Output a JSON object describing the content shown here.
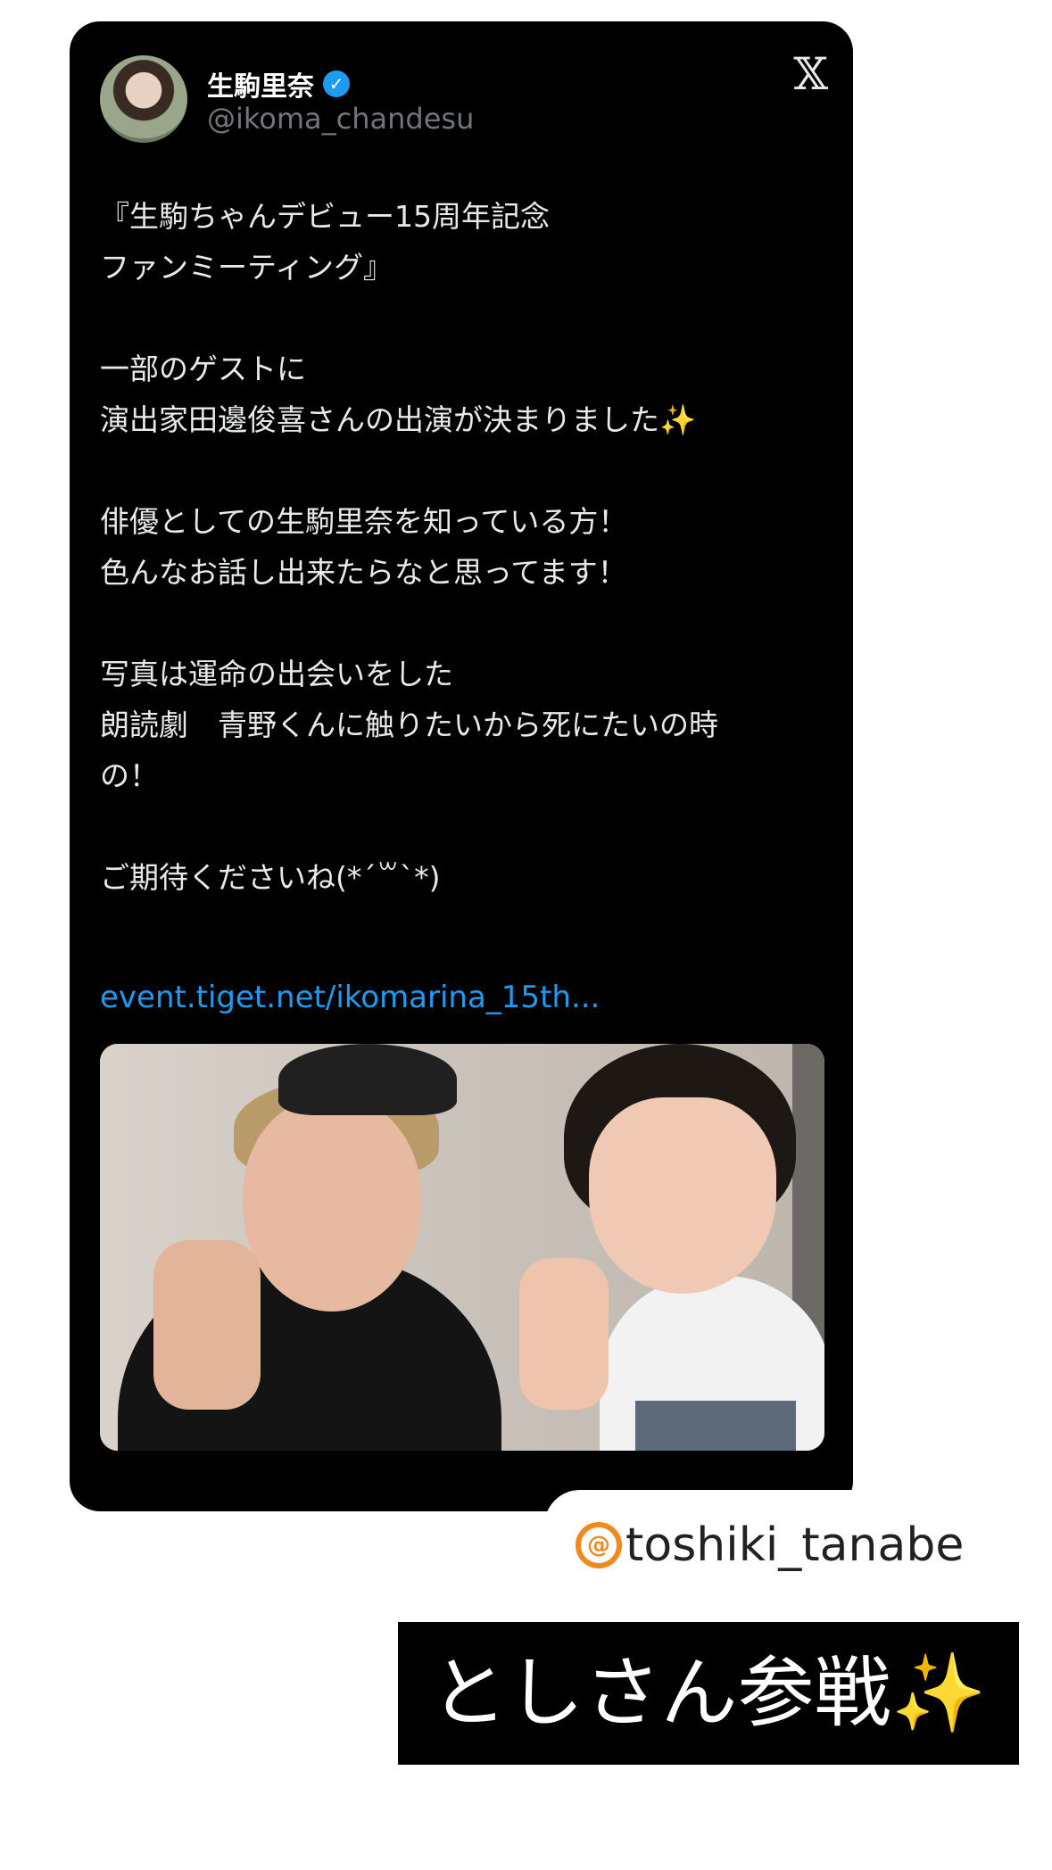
{
  "tweet": {
    "display_name": "生駒里奈",
    "verified_mark": "✓",
    "handle": "@ikoma_chandesu",
    "platform_logo": "𝕏",
    "paragraphs": [
      [
        "『生駒ちゃんデビュー15周年記念",
        "ファンミーティング』"
      ],
      [
        "一部のゲストに",
        "演出家田邊俊喜さんの出演が決まりました✨"
      ],
      [
        "俳優としての生駒里奈を知っている方！",
        "色んなお話し出来たらなと思ってます！"
      ],
      [
        "写真は運命の出会いをした",
        "朗読劇　青野くんに触りたいから死にたいの時",
        "の！"
      ],
      [
        "ご期待くださいね(*´꒳`*)"
      ]
    ],
    "link": "event.tiget.net/ikomarina_15th...",
    "icons": {
      "verified": "verified-badge-icon",
      "logo": "x-logo-icon"
    }
  },
  "threads": {
    "icon": "threads-icon",
    "icon_glyph": "@",
    "handle": "toshiki_tanabe"
  },
  "caption": "としさん参戦✨",
  "colors": {
    "card": "#000000",
    "link": "#1d9bf0",
    "verified": "#1d9bf0",
    "threads_accent": "#f08a1e"
  }
}
